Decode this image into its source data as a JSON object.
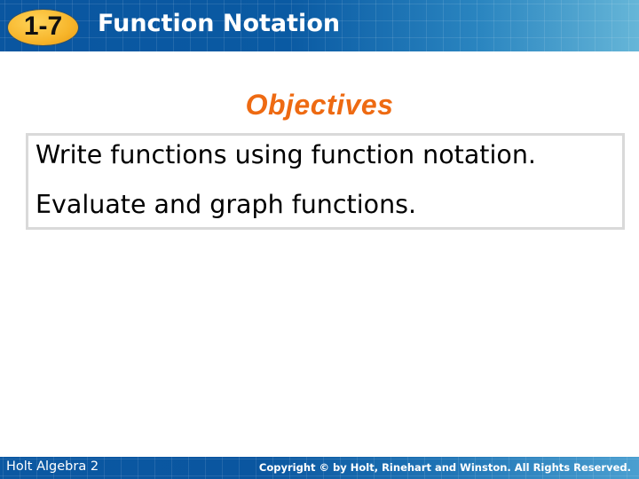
{
  "header": {
    "lesson_number": "1-7",
    "title": "Function Notation"
  },
  "main": {
    "heading": "Objectives",
    "objectives": [
      "Write functions using function notation.",
      "Evaluate and graph functions."
    ]
  },
  "footer": {
    "book": "Holt Algebra 2",
    "copyright": "Copyright © by Holt, Rinehart and Winston. All Rights Reserved."
  },
  "colors": {
    "header_blue": "#0a56a0",
    "badge_orange": "#f7b52a",
    "heading_orange": "#ee6a12",
    "box_border": "#d9d9d9"
  }
}
